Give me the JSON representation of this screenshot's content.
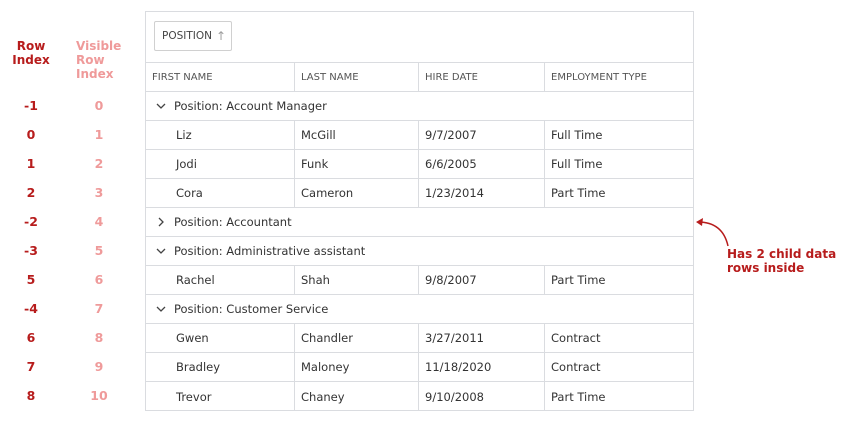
{
  "legend": {
    "row_index_label": "Row Index",
    "visible_row_index_label": "Visible Row Index"
  },
  "row_indices": [
    "-1",
    "0",
    "1",
    "2",
    "-2",
    "-3",
    "5",
    "-4",
    "6",
    "7",
    "8"
  ],
  "visible_row_indices": [
    "0",
    "1",
    "2",
    "3",
    "4",
    "5",
    "6",
    "7",
    "8",
    "9",
    "10"
  ],
  "group_panel": {
    "chip_label": "POSITION",
    "chip_icon": "arrow-up-icon"
  },
  "columns": [
    "FIRST NAME",
    "LAST NAME",
    "HIRE DATE",
    "EMPLOYMENT TYPE"
  ],
  "rows": [
    {
      "type": "group",
      "label": "Position: Account Manager",
      "expanded": true
    },
    {
      "type": "data",
      "cells": [
        "Liz",
        "McGill",
        "9/7/2007",
        "Full Time"
      ]
    },
    {
      "type": "data",
      "cells": [
        "Jodi",
        "Funk",
        "6/6/2005",
        "Full Time"
      ]
    },
    {
      "type": "data",
      "cells": [
        "Cora",
        "Cameron",
        "1/23/2014",
        "Part Time"
      ]
    },
    {
      "type": "group",
      "label": "Position: Accountant",
      "expanded": false
    },
    {
      "type": "group",
      "label": "Position: Administrative assistant",
      "expanded": true
    },
    {
      "type": "data",
      "cells": [
        "Rachel",
        "Shah",
        "9/8/2007",
        "Part Time"
      ]
    },
    {
      "type": "group",
      "label": "Position: Customer Service",
      "expanded": true
    },
    {
      "type": "data",
      "cells": [
        "Gwen",
        "Chandler",
        "3/27/2011",
        "Contract"
      ]
    },
    {
      "type": "data",
      "cells": [
        "Bradley",
        "Maloney",
        "11/18/2020",
        "Contract"
      ]
    },
    {
      "type": "data",
      "cells": [
        "Trevor",
        "Chaney",
        "9/10/2008",
        "Part Time"
      ]
    }
  ],
  "annotation": {
    "text": "Has 2 child data rows inside"
  },
  "colors": {
    "row_index": "#b71c1c",
    "visible_row_index": "#ef9a9a",
    "border": "#dadce0"
  }
}
